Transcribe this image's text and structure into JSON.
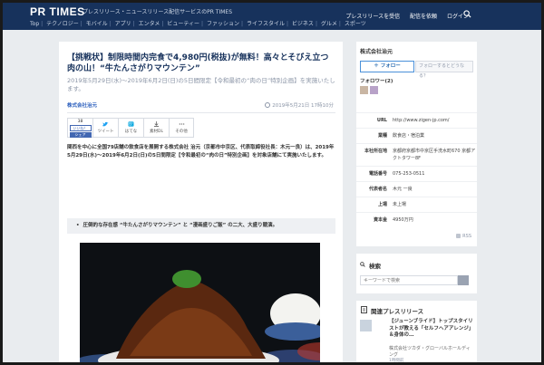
{
  "header": {
    "logo": "PR TIMES",
    "tagline": "プレスリリース・ニュースリリース配信サービスのPR TIMES",
    "nav": [
      "Top",
      "テクノロジー",
      "モバイル",
      "アプリ",
      "エンタメ",
      "ビューティー",
      "ファッション",
      "ライフスタイル",
      "ビジネス",
      "グルメ",
      "スポーツ"
    ],
    "links": [
      "プレスリリースを受信",
      "配信を依頼",
      "ログイン"
    ],
    "bg_color": "#17325c"
  },
  "article": {
    "title": "【挑戦状】制限時間内完食で4,980円(税抜)が無料！高々とそびえ立つ肉の山！“牛たんさがりマウンテン”",
    "subtitle": "2019年5月29日(水)～2019年6月2日(日)の5日間限定【令和最初の“肉の日”特別企画】を実施いたします。",
    "company": "株式会社治元",
    "date": "2019年5月21日 17時10分",
    "share": {
      "like_count": "38",
      "like_label": "いいね！",
      "share_label": "シェア",
      "tweet_label": "ツイート",
      "hatena_label": "はてな",
      "download_label": "素材DL",
      "other_label": "その他"
    },
    "lead": "関西を中心に全国79店舗の飲食店を展開する株式会社 治元（京都市中京区、代表取締役社長：木元一良）は、2019年5月29日(水)～2019年6月2日(日)の5日間限定【令和最初の“肉の日”特別企画】を対象店舗にて実施いたします。",
    "highlight": "圧倒的な存在感 “牛たんさがりマウンテン” と “漫画盛りご飯” の二大、大盛り競演。"
  },
  "sidebar": {
    "company": "株式会社治元",
    "follow_label": "フォロー",
    "follow_help": "フォローするとどうなる？",
    "followers": "フォロワー(2)",
    "info": [
      {
        "k": "URL",
        "v": "http://www.zigen-jp.com/"
      },
      {
        "k": "業種",
        "v": "飲食店・宿泊業"
      },
      {
        "k": "本社所在地",
        "v": "京都府京都市中京区手洗水町670 京都アクトタワー8F"
      },
      {
        "k": "電話番号",
        "v": "075-253-0511"
      },
      {
        "k": "代表者名",
        "v": "木元 一良"
      },
      {
        "k": "上場",
        "v": "未上場"
      },
      {
        "k": "資本金",
        "v": "4950万円"
      }
    ],
    "rss": "RSS"
  },
  "search": {
    "heading": "検索",
    "placeholder": "キーワードで検索"
  },
  "related": {
    "heading": "関連プレスリリース",
    "title": "【ジューンブライド】トップスタイリストが教える「セルフヘアアレンジ」＆身体の…",
    "company": "株式会社ツカダ・グローバルホールディング",
    "ago": "1時間前"
  }
}
